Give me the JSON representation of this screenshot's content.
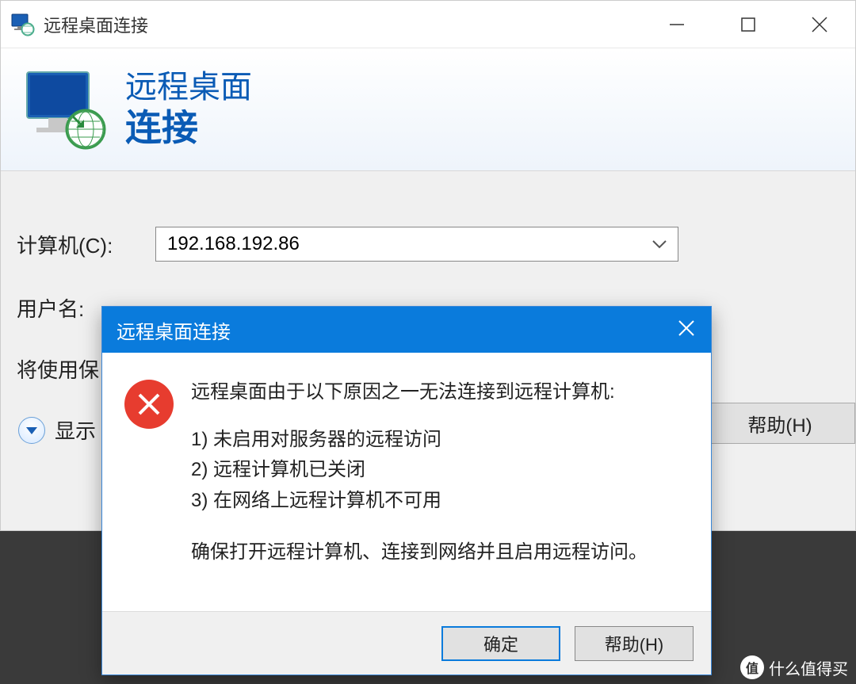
{
  "window": {
    "title": "远程桌面连接",
    "banner_line1": "远程桌面",
    "banner_line2": "连接"
  },
  "form": {
    "computer_label": "计算机(C):",
    "computer_value": "192.168.192.86",
    "username_label": "用户名:",
    "hint_prefix": "将使用保",
    "show_options_prefix": "显示",
    "help_button": "帮助(H)"
  },
  "dialog": {
    "title": "远程桌面连接",
    "heading": "远程桌面由于以下原因之一无法连接到远程计算机:",
    "reasons": [
      "1) 未启用对服务器的远程访问",
      "2) 远程计算机已关闭",
      "3) 在网络上远程计算机不可用"
    ],
    "footer": "确保打开远程计算机、连接到网络并且启用远程访问。",
    "ok_button": "确定",
    "help_button": "帮助(H)"
  },
  "watermark": {
    "badge": "值",
    "text": "什么值得买"
  }
}
